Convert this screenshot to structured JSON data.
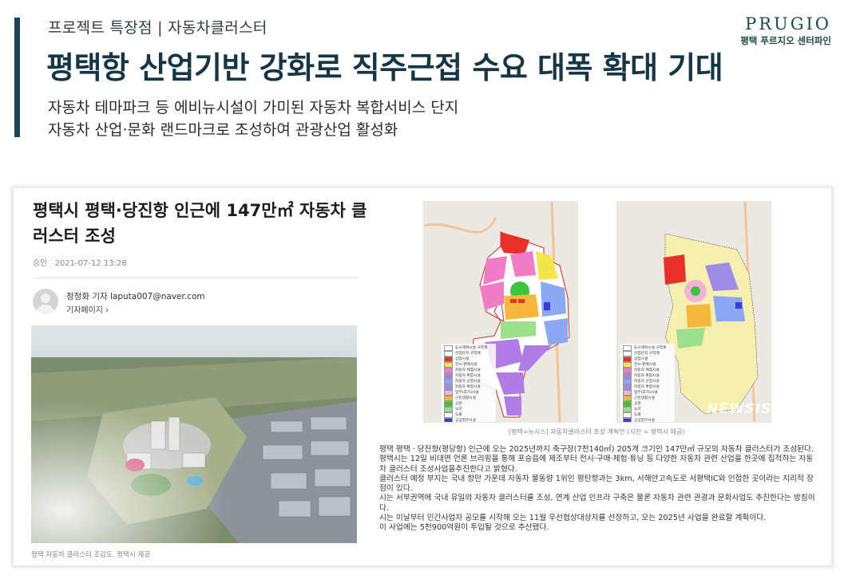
{
  "slide": {
    "kicker": "프로젝트 특장점 | 자동차클러스터",
    "headline": "평택항 산업기반 강화로 직주근접 수요 대폭 확대 기대",
    "sub_lines": [
      "자동차 테마파크 등 에비뉴시설이 가미된 자동차 복합서비스 단지",
      "자동차 산업·문화 랜드마크로 조성하여 관광산업 활성화"
    ],
    "brand": {
      "name": "PRUGIO",
      "tagline": "평택 푸르지오 센터파인"
    },
    "accent_color": "#1e4456"
  },
  "article": {
    "title": "평택시 평택·당진항 인근에 147만㎡ 자동차 클러스터 조성",
    "meta": {
      "label": "승인",
      "datetime": "2021-07-12 13:28"
    },
    "reporter": {
      "name": "정정화 기자  laputa007@naver.com",
      "page_link": "기자페이지 ›"
    },
    "photo_caption": "평택 자동차 클러스터 조감도. 평택시 제공",
    "map_caption": "[평택=뉴시스] 자동차클러스터 조성 계획안 (사진 = 평택시 제공)",
    "watermark": "NEWSIS",
    "legend": [
      {
        "label": "도시계획시설 구역계",
        "color": "#ffffff"
      },
      {
        "label": "산업단지 구역계",
        "color": "#ffffff"
      },
      {
        "label": "상업시설",
        "color": "#e8302a"
      },
      {
        "label": "전시·판매시설",
        "color": "#f6e44c"
      },
      {
        "label": "자동차 체험시설",
        "color": "#f07cc8"
      },
      {
        "label": "자동차 복합시설",
        "color": "#b07ce6"
      },
      {
        "label": "자동차 산업시설",
        "color": "#8da8f2"
      },
      {
        "label": "자동차 복합시설",
        "color": "#9f8ae8"
      },
      {
        "label": "업무(후가)시설",
        "color": "#f3b2d9"
      },
      {
        "label": "근린생활시설",
        "color": "#f6b83c"
      },
      {
        "label": "공원",
        "color": "#3cc43c"
      },
      {
        "label": "녹지",
        "color": "#9ee08a"
      },
      {
        "label": "도로",
        "color": "#ffffff"
      },
      {
        "label": "공공업무시설",
        "color": "#3a3ad8"
      },
      {
        "label": "복합에너지스테이션",
        "color": "#7a3ad0"
      },
      {
        "label": "저류지",
        "color": "#8ad4f0"
      },
      {
        "label": "주차장",
        "color": "#c9c9c9"
      }
    ],
    "paragraphs": [
      "평택 평택ㆍ당진항(평당항) 인근에 오는 2025년까지 축구장(7천140㎡) 205개 크기인 147만㎡ 규모의 자동차 클러스터가 조성된다.",
      "평택시는 12일 비대면 언론 브리핑을 통해 포승읍에 제조부터 전시·구매·체험·튜닝 등 다양한 자동차 관련 산업을 한곳에 집적하는 자동차 클러스터 조성사업을추진한다고 밝혔다.",
      "클러스터 예정 부지는 국내 항만 가운데 자동차 물동량 1위인 평탄항과는 3km, 서해안고속도로 서평택IC와 인접한 곳이라는 지리적 장점이 있다.",
      "시는 서부권역에 국내 유일의 자동차 클러스터를 조성, 연계 산업 인프라 구축은 물론 자동차 관련 관광과 문화사업도 추진한다는 방침이다.",
      "시는 이날부터 민간사업자 공모를 시작해 오는 11월 우선협상대상자를 선정하고, 오는 2025년 사업을 완료할 계획이다.",
      "이 사업에는 5천900억원이 투입될 것으로 추산됐다."
    ]
  }
}
